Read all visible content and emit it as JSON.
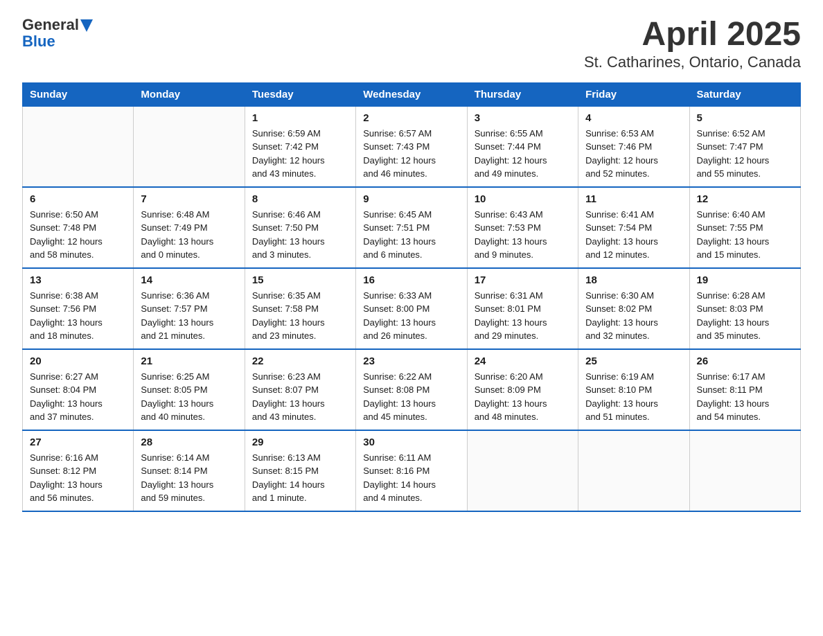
{
  "header": {
    "logo_general": "General",
    "logo_blue": "Blue",
    "title": "April 2025",
    "subtitle": "St. Catharines, Ontario, Canada"
  },
  "days_of_week": [
    "Sunday",
    "Monday",
    "Tuesday",
    "Wednesday",
    "Thursday",
    "Friday",
    "Saturday"
  ],
  "weeks": [
    [
      {
        "day": "",
        "info": ""
      },
      {
        "day": "",
        "info": ""
      },
      {
        "day": "1",
        "info": "Sunrise: 6:59 AM\nSunset: 7:42 PM\nDaylight: 12 hours\nand 43 minutes."
      },
      {
        "day": "2",
        "info": "Sunrise: 6:57 AM\nSunset: 7:43 PM\nDaylight: 12 hours\nand 46 minutes."
      },
      {
        "day": "3",
        "info": "Sunrise: 6:55 AM\nSunset: 7:44 PM\nDaylight: 12 hours\nand 49 minutes."
      },
      {
        "day": "4",
        "info": "Sunrise: 6:53 AM\nSunset: 7:46 PM\nDaylight: 12 hours\nand 52 minutes."
      },
      {
        "day": "5",
        "info": "Sunrise: 6:52 AM\nSunset: 7:47 PM\nDaylight: 12 hours\nand 55 minutes."
      }
    ],
    [
      {
        "day": "6",
        "info": "Sunrise: 6:50 AM\nSunset: 7:48 PM\nDaylight: 12 hours\nand 58 minutes."
      },
      {
        "day": "7",
        "info": "Sunrise: 6:48 AM\nSunset: 7:49 PM\nDaylight: 13 hours\nand 0 minutes."
      },
      {
        "day": "8",
        "info": "Sunrise: 6:46 AM\nSunset: 7:50 PM\nDaylight: 13 hours\nand 3 minutes."
      },
      {
        "day": "9",
        "info": "Sunrise: 6:45 AM\nSunset: 7:51 PM\nDaylight: 13 hours\nand 6 minutes."
      },
      {
        "day": "10",
        "info": "Sunrise: 6:43 AM\nSunset: 7:53 PM\nDaylight: 13 hours\nand 9 minutes."
      },
      {
        "day": "11",
        "info": "Sunrise: 6:41 AM\nSunset: 7:54 PM\nDaylight: 13 hours\nand 12 minutes."
      },
      {
        "day": "12",
        "info": "Sunrise: 6:40 AM\nSunset: 7:55 PM\nDaylight: 13 hours\nand 15 minutes."
      }
    ],
    [
      {
        "day": "13",
        "info": "Sunrise: 6:38 AM\nSunset: 7:56 PM\nDaylight: 13 hours\nand 18 minutes."
      },
      {
        "day": "14",
        "info": "Sunrise: 6:36 AM\nSunset: 7:57 PM\nDaylight: 13 hours\nand 21 minutes."
      },
      {
        "day": "15",
        "info": "Sunrise: 6:35 AM\nSunset: 7:58 PM\nDaylight: 13 hours\nand 23 minutes."
      },
      {
        "day": "16",
        "info": "Sunrise: 6:33 AM\nSunset: 8:00 PM\nDaylight: 13 hours\nand 26 minutes."
      },
      {
        "day": "17",
        "info": "Sunrise: 6:31 AM\nSunset: 8:01 PM\nDaylight: 13 hours\nand 29 minutes."
      },
      {
        "day": "18",
        "info": "Sunrise: 6:30 AM\nSunset: 8:02 PM\nDaylight: 13 hours\nand 32 minutes."
      },
      {
        "day": "19",
        "info": "Sunrise: 6:28 AM\nSunset: 8:03 PM\nDaylight: 13 hours\nand 35 minutes."
      }
    ],
    [
      {
        "day": "20",
        "info": "Sunrise: 6:27 AM\nSunset: 8:04 PM\nDaylight: 13 hours\nand 37 minutes."
      },
      {
        "day": "21",
        "info": "Sunrise: 6:25 AM\nSunset: 8:05 PM\nDaylight: 13 hours\nand 40 minutes."
      },
      {
        "day": "22",
        "info": "Sunrise: 6:23 AM\nSunset: 8:07 PM\nDaylight: 13 hours\nand 43 minutes."
      },
      {
        "day": "23",
        "info": "Sunrise: 6:22 AM\nSunset: 8:08 PM\nDaylight: 13 hours\nand 45 minutes."
      },
      {
        "day": "24",
        "info": "Sunrise: 6:20 AM\nSunset: 8:09 PM\nDaylight: 13 hours\nand 48 minutes."
      },
      {
        "day": "25",
        "info": "Sunrise: 6:19 AM\nSunset: 8:10 PM\nDaylight: 13 hours\nand 51 minutes."
      },
      {
        "day": "26",
        "info": "Sunrise: 6:17 AM\nSunset: 8:11 PM\nDaylight: 13 hours\nand 54 minutes."
      }
    ],
    [
      {
        "day": "27",
        "info": "Sunrise: 6:16 AM\nSunset: 8:12 PM\nDaylight: 13 hours\nand 56 minutes."
      },
      {
        "day": "28",
        "info": "Sunrise: 6:14 AM\nSunset: 8:14 PM\nDaylight: 13 hours\nand 59 minutes."
      },
      {
        "day": "29",
        "info": "Sunrise: 6:13 AM\nSunset: 8:15 PM\nDaylight: 14 hours\nand 1 minute."
      },
      {
        "day": "30",
        "info": "Sunrise: 6:11 AM\nSunset: 8:16 PM\nDaylight: 14 hours\nand 4 minutes."
      },
      {
        "day": "",
        "info": ""
      },
      {
        "day": "",
        "info": ""
      },
      {
        "day": "",
        "info": ""
      }
    ]
  ]
}
